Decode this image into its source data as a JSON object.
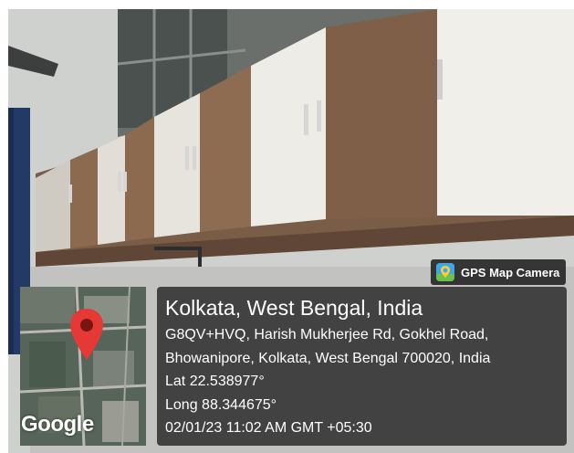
{
  "badge": {
    "label": "GPS Map Camera",
    "icon": "map-pin-app-icon"
  },
  "map": {
    "logo_text": "Google",
    "marker_icon": "map-marker-icon",
    "marker_color": "#e53935"
  },
  "location": {
    "title": "Kolkata, West Bengal, India",
    "address_line_1": "G8QV+HVQ, Harish Mukherjee Rd, Gokhel Road,",
    "address_line_2": "Bhowanipore, Kolkata, West Bengal 700020, India",
    "lat": "Lat 22.538977°",
    "long": "Long 88.344675°",
    "timestamp": "02/01/23 11:02 AM GMT +05:30"
  },
  "colors": {
    "panel_bg": "#262626",
    "badge_bg": "#282828",
    "text": "#ffffff"
  }
}
